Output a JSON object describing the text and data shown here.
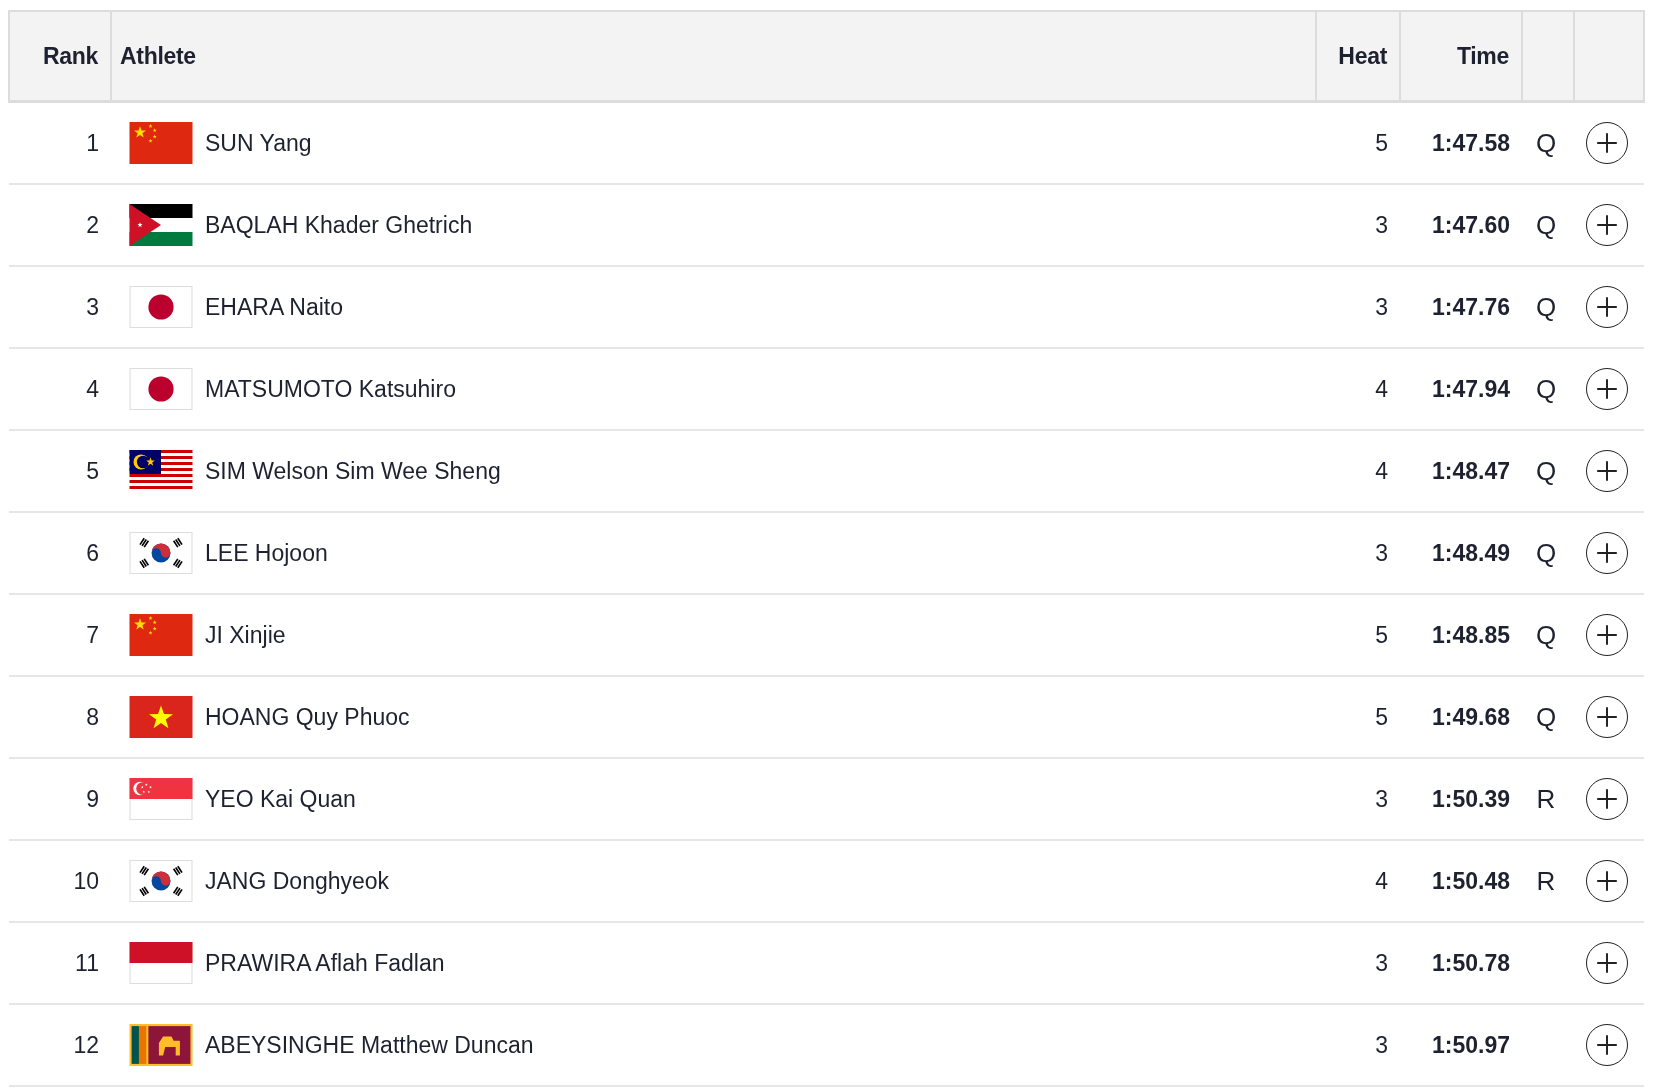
{
  "table": {
    "columns": [
      {
        "label": "Rank"
      },
      {
        "label": "Athlete"
      },
      {
        "label": "Heat"
      },
      {
        "label": "Time"
      }
    ],
    "rows": [
      {
        "rank": "1",
        "flag": {
          "kind": "cn"
        },
        "athlete": "SUN Yang",
        "heat": "5",
        "time": "1:47.58",
        "qualifier": "Q"
      },
      {
        "rank": "2",
        "flag": {
          "kind": "jo"
        },
        "athlete": "BAQLAH Khader Ghetrich",
        "heat": "3",
        "time": "1:47.60",
        "qualifier": "Q"
      },
      {
        "rank": "3",
        "flag": {
          "kind": "jp"
        },
        "athlete": "EHARA Naito",
        "heat": "3",
        "time": "1:47.76",
        "qualifier": "Q"
      },
      {
        "rank": "4",
        "flag": {
          "kind": "jp"
        },
        "athlete": "MATSUMOTO Katsuhiro",
        "heat": "4",
        "time": "1:47.94",
        "qualifier": "Q"
      },
      {
        "rank": "5",
        "flag": {
          "kind": "my"
        },
        "athlete": "SIM Welson Sim Wee Sheng",
        "heat": "4",
        "time": "1:48.47",
        "qualifier": "Q"
      },
      {
        "rank": "6",
        "flag": {
          "kind": "kr"
        },
        "athlete": "LEE Hojoon",
        "heat": "3",
        "time": "1:48.49",
        "qualifier": "Q"
      },
      {
        "rank": "7",
        "flag": {
          "kind": "cn"
        },
        "athlete": "JI Xinjie",
        "heat": "5",
        "time": "1:48.85",
        "qualifier": "Q"
      },
      {
        "rank": "8",
        "flag": {
          "kind": "vn"
        },
        "athlete": "HOANG Quy Phuoc",
        "heat": "5",
        "time": "1:49.68",
        "qualifier": "Q"
      },
      {
        "rank": "9",
        "flag": {
          "kind": "sg"
        },
        "athlete": "YEO Kai Quan",
        "heat": "3",
        "time": "1:50.39",
        "qualifier": "R"
      },
      {
        "rank": "10",
        "flag": {
          "kind": "kr"
        },
        "athlete": "JANG Donghyeok",
        "heat": "4",
        "time": "1:50.48",
        "qualifier": "R"
      },
      {
        "rank": "11",
        "flag": {
          "kind": "id"
        },
        "athlete": "PRAWIRA Aflah Fadlan",
        "heat": "3",
        "time": "1:50.78"
      },
      {
        "rank": "12",
        "flag": {
          "kind": "lk"
        },
        "athlete": "ABEYSINGHE Matthew Duncan",
        "heat": "3",
        "time": "1:50.97"
      }
    ]
  }
}
